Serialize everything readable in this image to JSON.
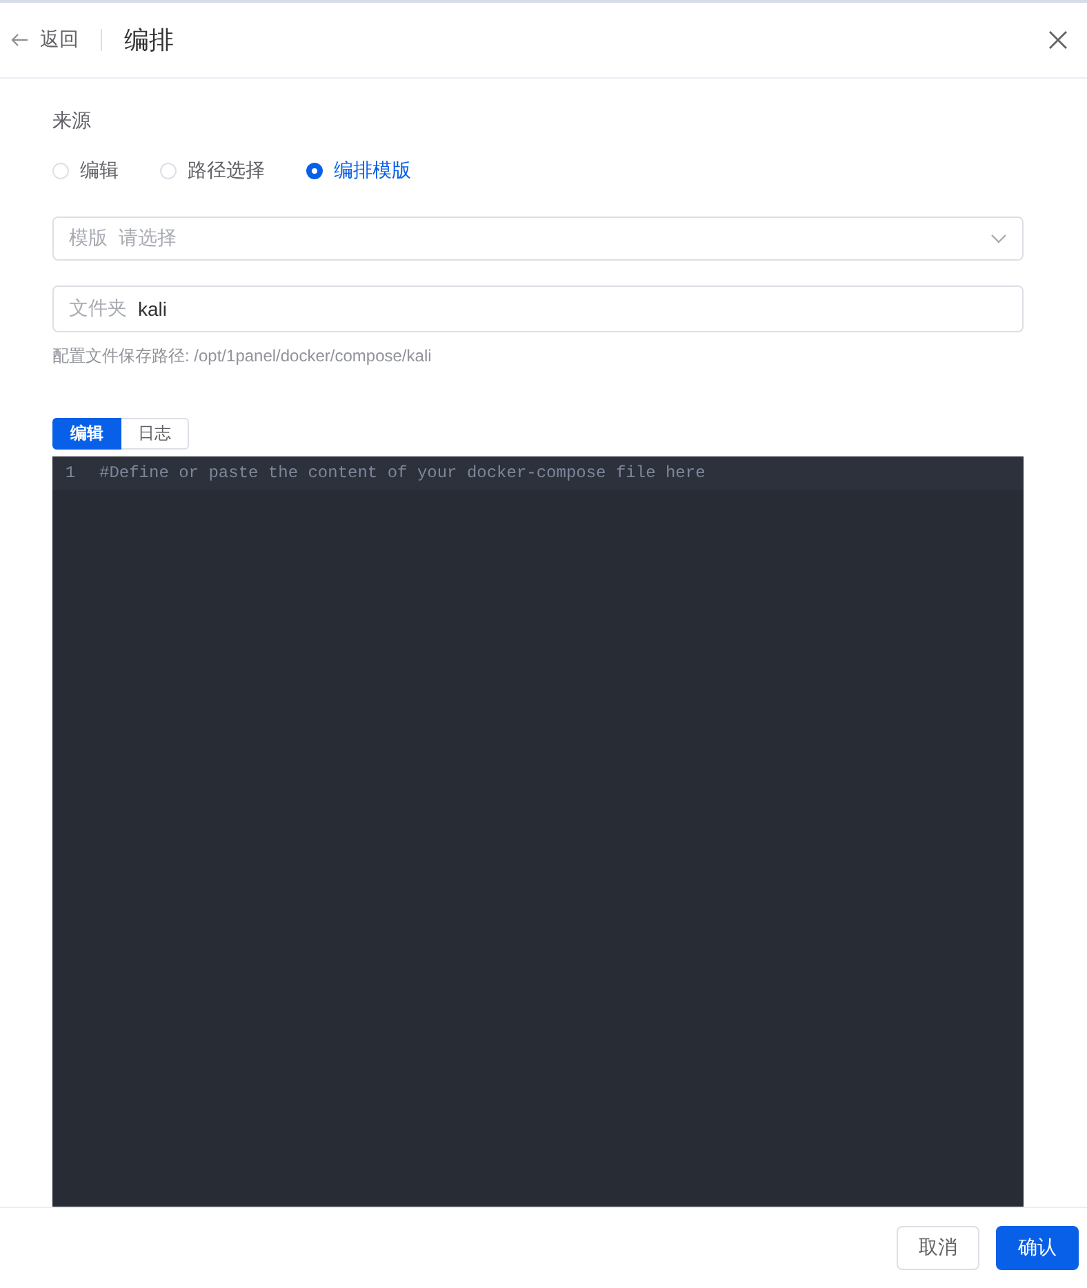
{
  "header": {
    "back": "返回",
    "title": "编排"
  },
  "source": {
    "label": "来源",
    "options": [
      {
        "label": "编辑",
        "selected": false
      },
      {
        "label": "路径选择",
        "selected": false
      },
      {
        "label": "编排模版",
        "selected": true
      }
    ]
  },
  "template_select": {
    "prefix": "模版",
    "placeholder": "请选择"
  },
  "folder_field": {
    "prefix": "文件夹",
    "value": "kali"
  },
  "path_hint": "配置文件保存路径: /opt/1panel/docker/compose/kali",
  "editor_tabs": [
    {
      "label": "编辑",
      "selected": true
    },
    {
      "label": "日志",
      "selected": false
    }
  ],
  "editor": {
    "line_number": "1",
    "placeholder": "#Define or paste the content of your docker-compose file here"
  },
  "footer": {
    "cancel": "取消",
    "confirm": "确认"
  }
}
